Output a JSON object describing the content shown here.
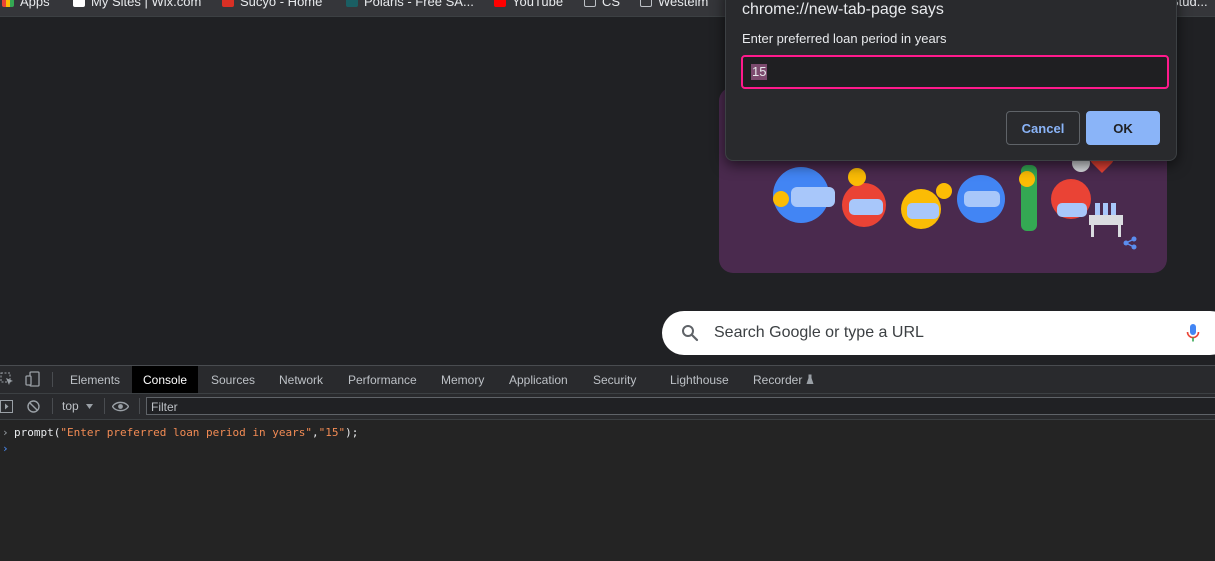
{
  "bookmarks": [
    {
      "label": "Apps"
    },
    {
      "label": "My Sites | Wix.com"
    },
    {
      "label": "Sucyo - Home"
    },
    {
      "label": "Polaris - Free SA..."
    },
    {
      "label": "YouTube"
    },
    {
      "label": "CS"
    },
    {
      "label": "Westelm"
    },
    {
      "label": "Stud..."
    }
  ],
  "search": {
    "placeholder": "Search Google or type a URL"
  },
  "dialog": {
    "title": "chrome://new-tab-page says",
    "message": "Enter preferred loan period in years",
    "input_value": "15",
    "cancel_label": "Cancel",
    "ok_label": "OK"
  },
  "devtools": {
    "tabs": [
      {
        "label": "Elements"
      },
      {
        "label": "Console",
        "active": true
      },
      {
        "label": "Sources"
      },
      {
        "label": "Network"
      },
      {
        "label": "Performance"
      },
      {
        "label": "Memory"
      },
      {
        "label": "Application"
      },
      {
        "label": "Security"
      },
      {
        "label": "Lighthouse"
      },
      {
        "label": "Recorder"
      }
    ],
    "context_label": "top",
    "filter_placeholder": "Filter",
    "console": {
      "cmd_prefix": "prompt(",
      "cmd_arg1": "\"Enter preferred loan period in years\"",
      "cmd_sep": ",",
      "cmd_arg2": "\"15\"",
      "cmd_suffix": ");"
    }
  },
  "colors": {
    "accent": "#8ab4f8",
    "focus_ring": "#ff1a8c",
    "doodle_bg": "#4a2a4e"
  }
}
